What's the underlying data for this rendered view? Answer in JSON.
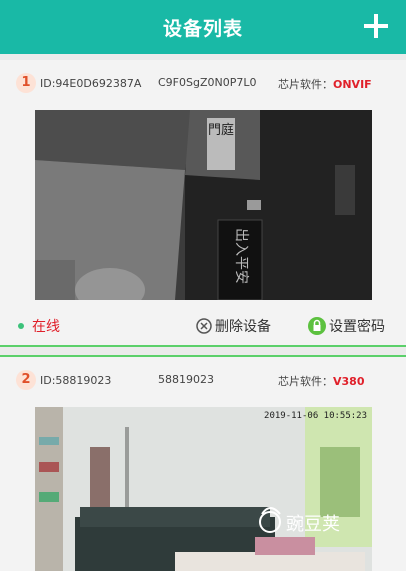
{
  "header": {
    "title": "设备列表",
    "add_icon": "plus-icon"
  },
  "devices": [
    {
      "index": "1",
      "id": "ID:94E0D692387A",
      "serial": "C9F0SgZ0N0P7L0",
      "chip_label": "芯片软件：",
      "chip_value": "ONVIF",
      "status": "在线",
      "delete_label": "删除设备",
      "password_label": "设置密码",
      "sign_text": "出入平安",
      "poster_text": "門庭"
    },
    {
      "index": "2",
      "id": "ID:58819023",
      "serial": "58819023",
      "chip_label": "芯片软件：",
      "chip_value": "V380",
      "timestamp": "2019-11-06 10:55:23"
    }
  ],
  "watermark": "豌豆荚",
  "colors": {
    "header": "#19b9a6",
    "accent_red": "#e0202a",
    "divider_green": "#5bd06a",
    "online_dot": "#3cc27a"
  }
}
